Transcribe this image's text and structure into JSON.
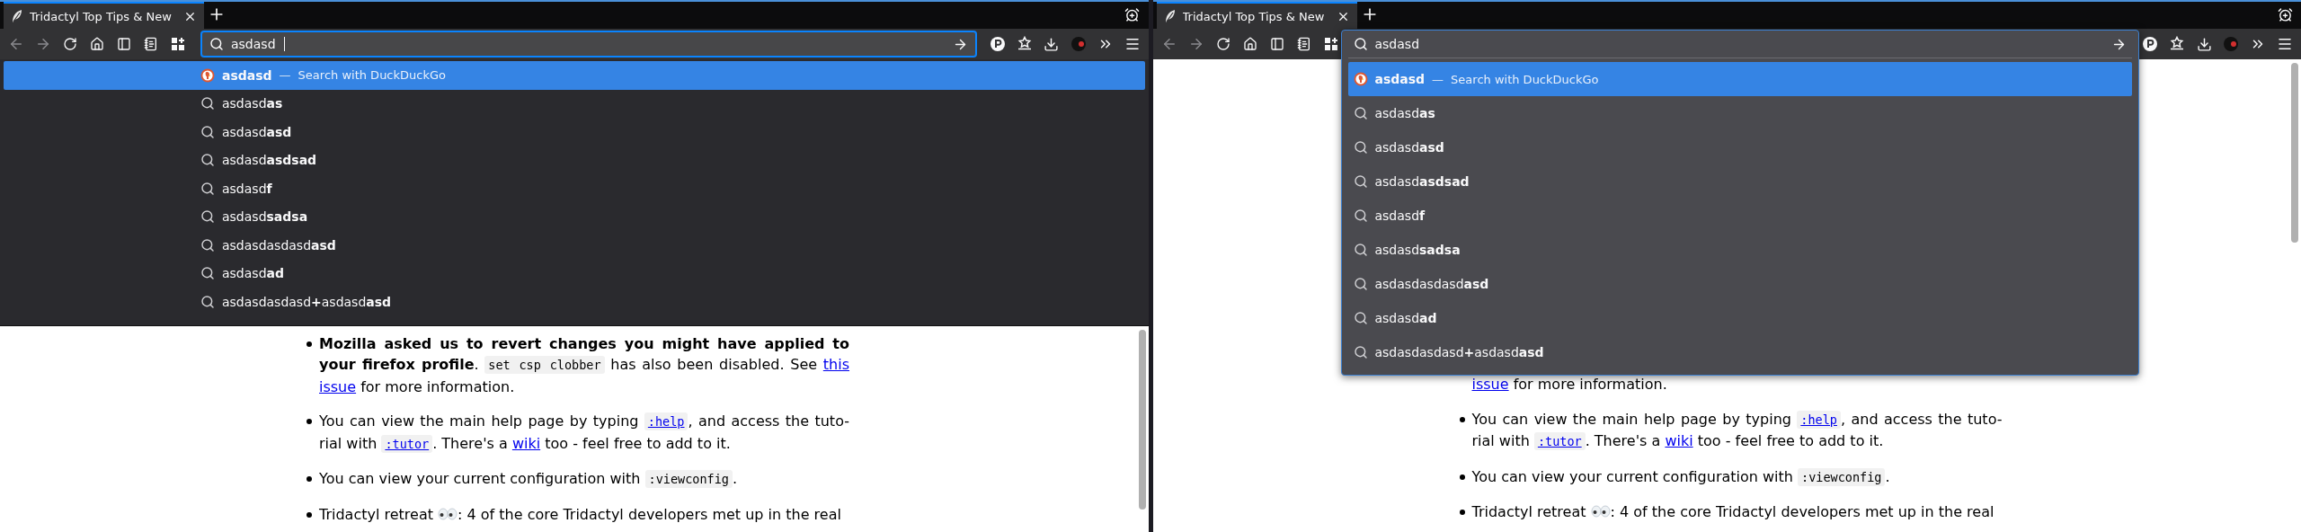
{
  "windows": [
    {
      "tab": {
        "title": "Tridactyl Top Tips & New",
        "selected": true
      },
      "url_field": {
        "value": "asdasd",
        "focused": true
      },
      "dropdown": {
        "kind": "panel",
        "separator": "—",
        "suggestions": [
          {
            "kind": "engine",
            "text": "asdasd",
            "action": "Search with DuckDuckGo",
            "selected": true
          },
          {
            "kind": "search",
            "text": "asdasd**as**",
            "selected": false
          },
          {
            "kind": "search",
            "text": "asdasd**asd**",
            "selected": false
          },
          {
            "kind": "search",
            "text": "asdasd**asdsad**",
            "selected": false
          },
          {
            "kind": "search",
            "text": "asdasd**f**",
            "selected": false
          },
          {
            "kind": "search",
            "text": "asdasd**sadsa**",
            "selected": false
          },
          {
            "kind": "search",
            "text": "asdasdasdasd**asd**",
            "selected": false
          },
          {
            "kind": "search",
            "text": "asdasd**ad**",
            "selected": false
          },
          {
            "kind": "search",
            "text": "asdasdasdasd**+**asdasd**asd**",
            "selected": false
          }
        ]
      },
      "page": {
        "items": [
          {
            "continued": false,
            "parts": [
              {
                "kind": "bold",
                "text": "Mozilla asked us to revert changes you might have applied to your firefox profile"
              },
              {
                "kind": "plain",
                "text": ". "
              },
              {
                "kind": "code",
                "text": "set csp clobber"
              },
              {
                "kind": "plain",
                "text": " has also been disabled. See "
              },
              {
                "kind": "link",
                "text": "this"
              },
              {
                "kind": "link",
                "text": "issue",
                "gap_before": true
              },
              {
                "kind": "plain",
                "text": " for more information."
              }
            ]
          },
          {
            "continued": false,
            "parts": [
              {
                "kind": "plain",
                "text": "You can view the main help page by typing "
              },
              {
                "kind": "code_link",
                "text": ":help"
              },
              {
                "kind": "plain",
                "text": ", and access the tuto-rial with "
              },
              {
                "kind": "code_link",
                "text": ":tutor"
              },
              {
                "kind": "plain",
                "text": ". There's a "
              },
              {
                "kind": "link",
                "text": "wiki"
              },
              {
                "kind": "plain",
                "text": " too - feel free to add to it."
              }
            ]
          },
          {
            "continued": false,
            "parts": [
              {
                "kind": "plain",
                "text": "You can view your current configuration with "
              },
              {
                "kind": "code",
                "text": ":viewconfig"
              },
              {
                "kind": "plain",
                "text": "."
              }
            ]
          },
          {
            "continued": false,
            "parts": [
              {
                "kind": "plain",
                "text": "Tridactyl retreat "
              },
              {
                "kind": "eyes"
              },
              {
                "kind": "plain",
                "text": ": 4 of the core Tridactyl developers met up in the real"
              }
            ]
          }
        ]
      }
    },
    {
      "tab": {
        "title": "Tridactyl Top Tips & New",
        "selected": true
      },
      "url_field": {
        "value": "asdasd",
        "focused": false
      },
      "dropdown": {
        "kind": "popup",
        "separator": "—",
        "suggestions": [
          {
            "kind": "engine",
            "text": "asdasd",
            "action": "Search with DuckDuckGo",
            "selected": true
          },
          {
            "kind": "search",
            "text": "asdasd**as**",
            "selected": false
          },
          {
            "kind": "search",
            "text": "asdasd**asd**",
            "selected": false
          },
          {
            "kind": "search",
            "text": "asdasd**asdsad**",
            "selected": false
          },
          {
            "kind": "search",
            "text": "asdasd**f**",
            "selected": false
          },
          {
            "kind": "search",
            "text": "asdasd**sadsa**",
            "selected": false
          },
          {
            "kind": "search",
            "text": "asdasdasdasd**asd**",
            "selected": false
          },
          {
            "kind": "search",
            "text": "asdasd**ad**",
            "selected": false
          },
          {
            "kind": "search",
            "text": "asdasdasdasd**+**asdasd**asd**",
            "selected": false
          }
        ]
      },
      "page": {
        "items": [
          {
            "continued": true,
            "parts": [
              {
                "kind": "link",
                "text": "issue"
              },
              {
                "kind": "plain",
                "text": " for more information."
              }
            ]
          },
          {
            "continued": false,
            "parts": [
              {
                "kind": "plain",
                "text": "You can view the main help page by typing "
              },
              {
                "kind": "code_link",
                "text": ":help"
              },
              {
                "kind": "plain",
                "text": ", and access the tuto-rial with "
              },
              {
                "kind": "code_link",
                "text": ":tutor"
              },
              {
                "kind": "plain",
                "text": ". There's a "
              },
              {
                "kind": "link",
                "text": "wiki"
              },
              {
                "kind": "plain",
                "text": " too - feel free to add to it."
              }
            ]
          },
          {
            "continued": false,
            "parts": [
              {
                "kind": "plain",
                "text": "You can view your current configuration with "
              },
              {
                "kind": "code",
                "text": ":viewconfig"
              },
              {
                "kind": "plain",
                "text": "."
              }
            ]
          },
          {
            "continued": false,
            "parts": [
              {
                "kind": "plain",
                "text": "Tridactyl retreat "
              },
              {
                "kind": "eyes"
              },
              {
                "kind": "plain",
                "text": ": 4 of the core Tridactyl developers met up in the real"
              }
            ]
          }
        ]
      }
    }
  ]
}
